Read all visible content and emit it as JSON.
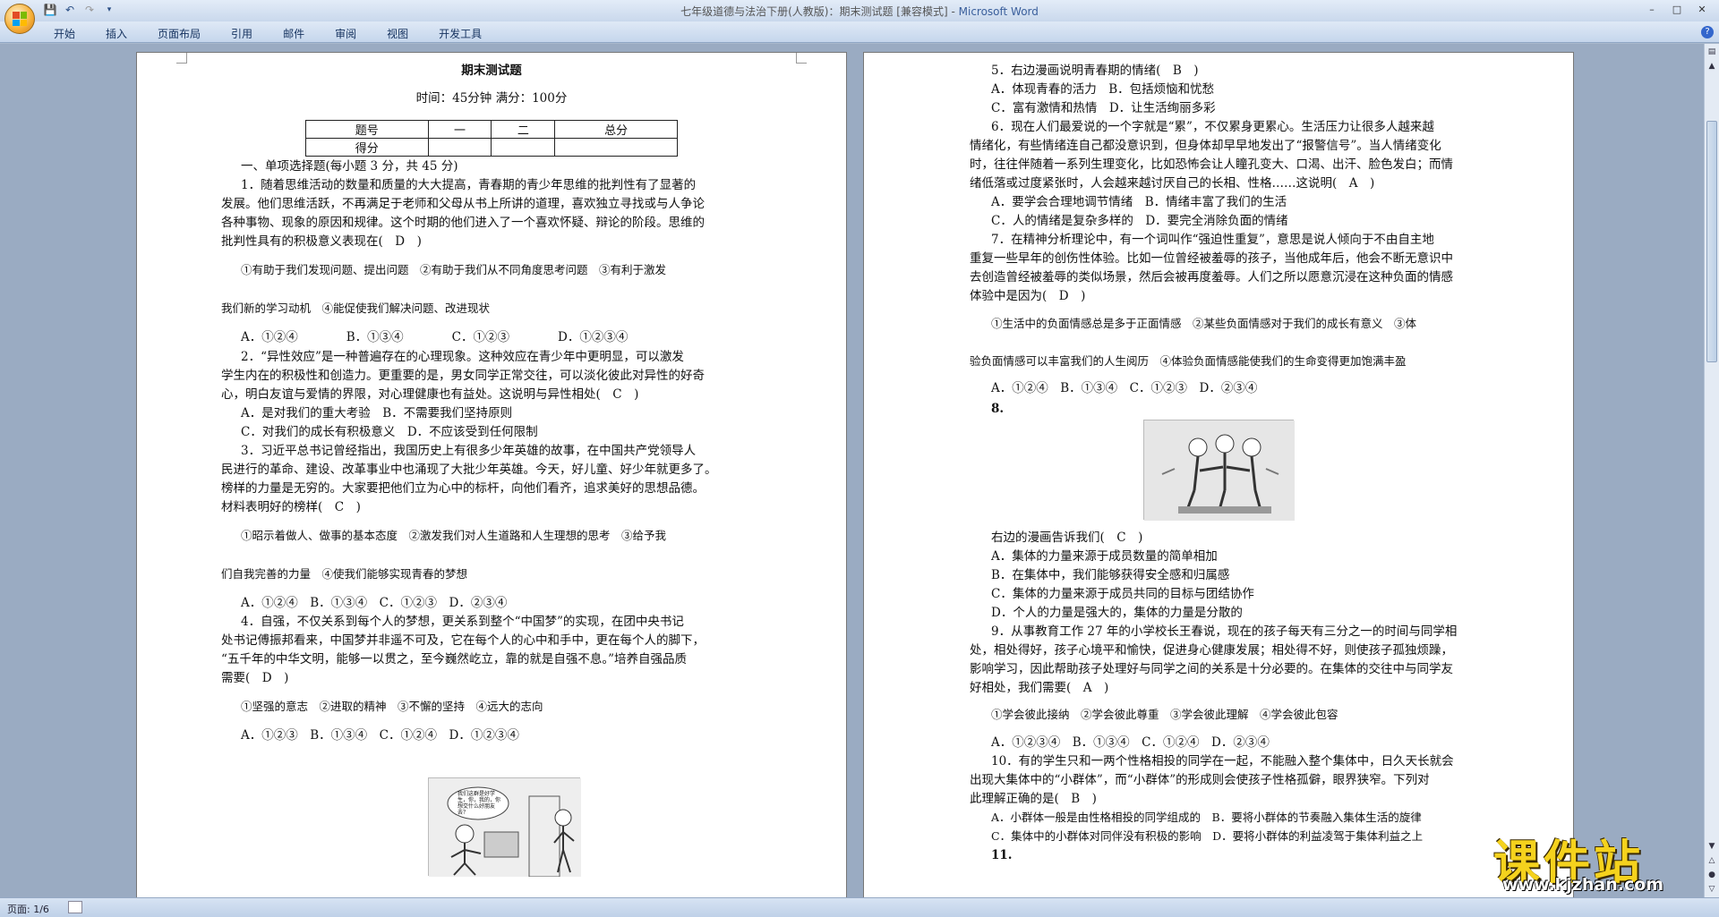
{
  "window": {
    "title": "七年级道德与法治下册(人教版)：期末测试题 [兼容模式]",
    "app": "Microsoft Word"
  },
  "ribbon": {
    "tabs": [
      "开始",
      "插入",
      "页面布局",
      "引用",
      "邮件",
      "审阅",
      "视图",
      "开发工具"
    ]
  },
  "page1": {
    "title": "期末测试题",
    "subtitle": "时间：45分钟      满分：100分",
    "score_table": {
      "headers": [
        "题号",
        "一",
        "二",
        "总分"
      ],
      "row_label": "得分"
    },
    "lines": [
      "一、单项选择题(每小题 3 分，共 45 分)",
      "1．随着思维活动的数量和质量的大大提高，青春期的青少年思维的批判性有了显著的",
      "发展。他们思维活跃，不再满足于老师和父母从书上所讲的道理，喜欢独立寻找或与人争论",
      "各种事物、现象的原因和规律。这个时期的他们进入了一个喜欢怀疑、辩论的阶段。思维的",
      "批判性具有的积极意义表现在(　D　)",
      "①有助于我们发现问题、提出问题　②有助于我们从不同角度思考问题　③有利于激发",
      "我们新的学习动机　④能促使我们解决问题、改进现状",
      "A．①②④　　　　B．①③④　　　　C．①②③　　　　D．①②③④",
      "2．“异性效应”是一种普遍存在的心理现象。这种效应在青少年中更明显，可以激发",
      "学生内在的积极性和创造力。更重要的是，男女同学正常交往，可以淡化彼此对异性的好奇",
      "心，明白友谊与爱情的界限，对心理健康也有益处。这说明与异性相处(　C　)",
      "A．是对我们的重大考验　B．不需要我们坚持原则",
      "C．对我们的成长有积极意义　D．不应该受到任何限制",
      "3．习近平总书记曾经指出，我国历史上有很多少年英雄的故事，在中国共产党领导人",
      "民进行的革命、建设、改革事业中也涌现了大批少年英雄。今天，好儿童、好少年就更多了。",
      "榜样的力量是无穷的。大家要把他们立为心中的标杆，向他们看齐，追求美好的思想品德。",
      "材料表明好的榜样(　C　)",
      "①昭示着做人、做事的基本态度　②激发我们对人生道路和人生理想的思考　③给予我",
      "们自我完善的力量　④使我们能够实现青春的梦想",
      "A．①②④　B．①③④　C．①②③　D．②③④",
      "4．自强，不仅关系到每个人的梦想，更关系到整个“中国梦”的实现，在团中央书记",
      "处书记傅振邦看来，中国梦并非遥不可及，它在每个人的心中和手中，更在每个人的脚下，",
      "“五千年的中华文明，能够一以贯之，至今巍然屹立，靠的就是自强不息。”培养自强品质",
      "需要(　D　)",
      "①坚强的意志　②进取的精神　③不懈的坚持　④远大的志向",
      "A．①②③　B．①③④　C．①②④　D．①②③④"
    ],
    "cartoon_caption": "我们这群是好学生，你，我的，你想交什么好朋友去？"
  },
  "page2": {
    "lines": [
      "5．右边漫画说明青春期的情绪(　B　)",
      "A．体现青春的活力　B．包括烦恼和忧愁",
      "C．富有激情和热情　D．让生活绚丽多彩",
      "6．现在人们最爱说的一个字就是“累”，不仅累身更累心。生活压力让很多人越来越",
      "情绪化，有些情绪连自己都没意识到，但身体却早早地发出了“报警信号”。当人情绪变化",
      "时，往往伴随着一系列生理变化，比如恐怖会让人瞳孔变大、口渴、出汗、脸色发白；而情",
      "绪低落或过度紧张时，人会越来越讨厌自己的长相、性格……这说明(　A　)",
      "A．要学会合理地调节情绪　B．情绪丰富了我们的生活",
      "C．人的情绪是复杂多样的　D．要完全消除负面的情绪",
      "7．在精神分析理论中，有一个词叫作“强迫性重复”，意思是说人倾向于不由自主地",
      "重复一些早年的创伤性体验。比如一位曾经被羞辱的孩子，当他成年后，他会不断无意识中",
      "去创造曾经被羞辱的类似场景，然后会被再度羞辱。人们之所以愿意沉浸在这种负面的情感",
      "体验中是因为(　D　)",
      "①生活中的负面情感总是多于正面情感　②某些负面情感对于我们的成长有意义　③体",
      "验负面情感可以丰富我们的人生阅历　④体验负面情感能使我们的生命变得更加饱满丰盈",
      "A．①②④　B．①③④　C．①②③　D．②③④",
      "8.",
      "右边的漫画告诉我们(　C　)",
      "A．集体的力量来源于成员数量的简单相加",
      "B．在集体中，我们能够获得安全感和归属感",
      "C．集体的力量来源于成员共同的目标与团结协作",
      "D．个人的力量是强大的，集体的力量是分散的",
      "9．从事教育工作 27 年的小学校长王春说，现在的孩子每天有三分之一的时间与同学相",
      "处，相处得好，孩子心境平和愉快，促进身心健康发展；相处得不好，则使孩子孤独烦躁，",
      "影响学习，因此帮助孩子处理好与同学之间的关系是十分必要的。在集体的交往中与同学友",
      "好相处，我们需要(　A　)",
      "①学会彼此接纳　②学会彼此尊重　③学会彼此理解　④学会彼此包容",
      "A．①②③④　B．①③④　C．①②④　D．②③④",
      "10．有的学生只和一两个性格相投的同学在一起，不能融入整个集体中，日久天长就会",
      "出现大集体中的“小群体”，而“小群体”的形成则会使孩子性格孤僻，眼界狭窄。下列对",
      "此理解正确的是(　B　)",
      "A．小群体一般是由性格相投的同学组成的　B．要将小群体的节奏融入集体生活的旋律",
      "C．集体中的小群体对同伴没有积极的影响　D．要将小群体的利益凌驾于集体利益之上",
      "11."
    ]
  },
  "statusbar": {
    "page": "页面: 1/6"
  },
  "watermark": {
    "text": "课件站",
    "url": "www.kjzhan.com"
  }
}
